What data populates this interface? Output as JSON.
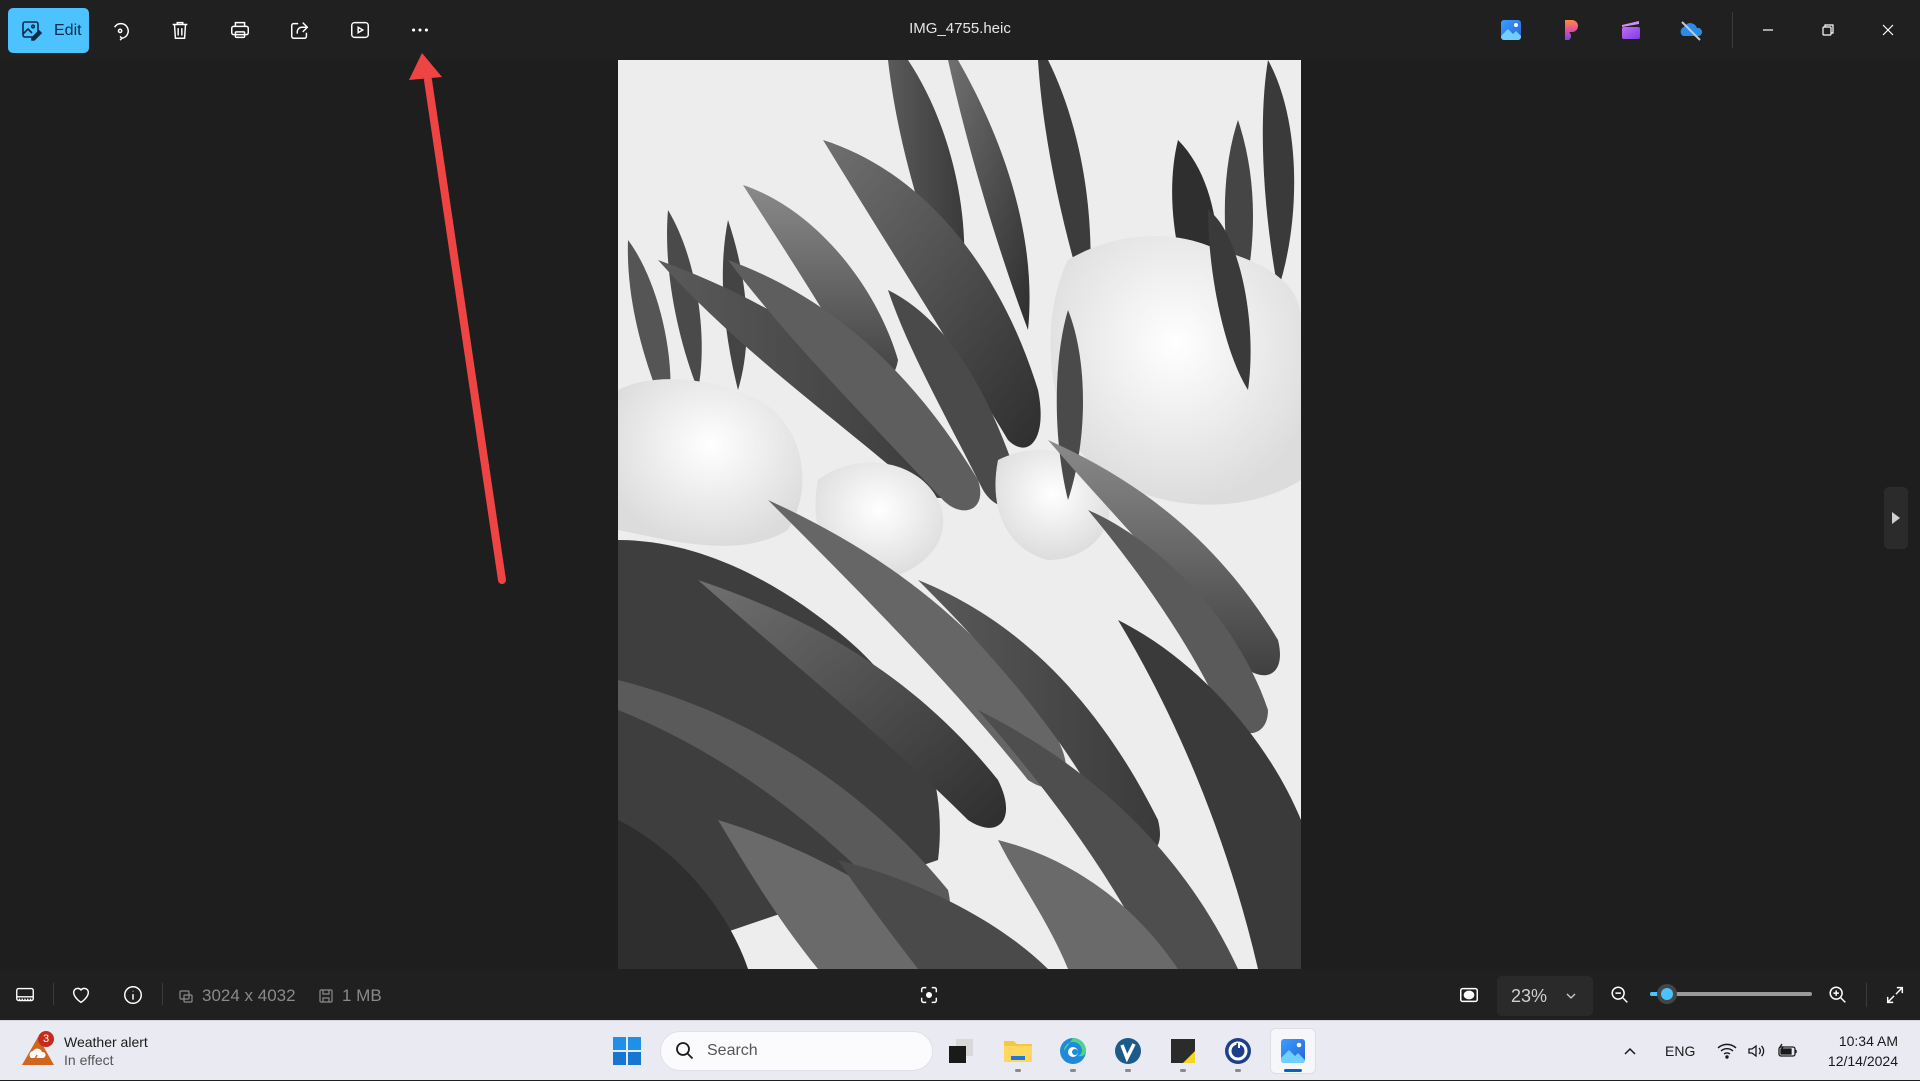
{
  "window": {
    "title": "IMG_4755.heic"
  },
  "toolbar": {
    "edit_label": "Edit",
    "buttons": [
      {
        "name": "rotate",
        "icon": "rotate-icon"
      },
      {
        "name": "delete",
        "icon": "trash-icon"
      },
      {
        "name": "print",
        "icon": "print-icon"
      },
      {
        "name": "share",
        "icon": "share-icon"
      },
      {
        "name": "slideshow",
        "icon": "slideshow-icon"
      },
      {
        "name": "more",
        "icon": "more-options-icon"
      }
    ],
    "app_icons": [
      "photos-icon",
      "clipchamp-icon",
      "designer-icon",
      "onedrive-off-icon"
    ]
  },
  "window_controls": [
    "minimize",
    "restore",
    "close"
  ],
  "viewer": {
    "image_description": "Black and white close-up of succulent leaves covered with snow",
    "next_button_icon": "next-arrow-icon"
  },
  "bottom_bar": {
    "dimensions": "3024 x 4032",
    "file_size": "1 MB",
    "zoom_level": "23%",
    "zoom_slider_fraction": 0.05
  },
  "annotation": {
    "type": "arrow",
    "color": "#ef4444",
    "points_to": "more-options-button"
  },
  "taskbar": {
    "weather_title": "Weather alert",
    "weather_subtitle": "In effect",
    "weather_badge": "3",
    "search_placeholder": "Search",
    "apps": [
      "Task View",
      "File Explorer",
      "Microsoft Edge",
      "Veeam",
      "Sticky Notes",
      "Power Automate",
      "Photos"
    ],
    "active_app": "Photos",
    "language": "ENG",
    "time": "10:34 AM",
    "date": "12/14/2024"
  },
  "colors": {
    "accent": "#4cc2ff",
    "background": "#202020",
    "taskbar": "#eaeaf3"
  }
}
